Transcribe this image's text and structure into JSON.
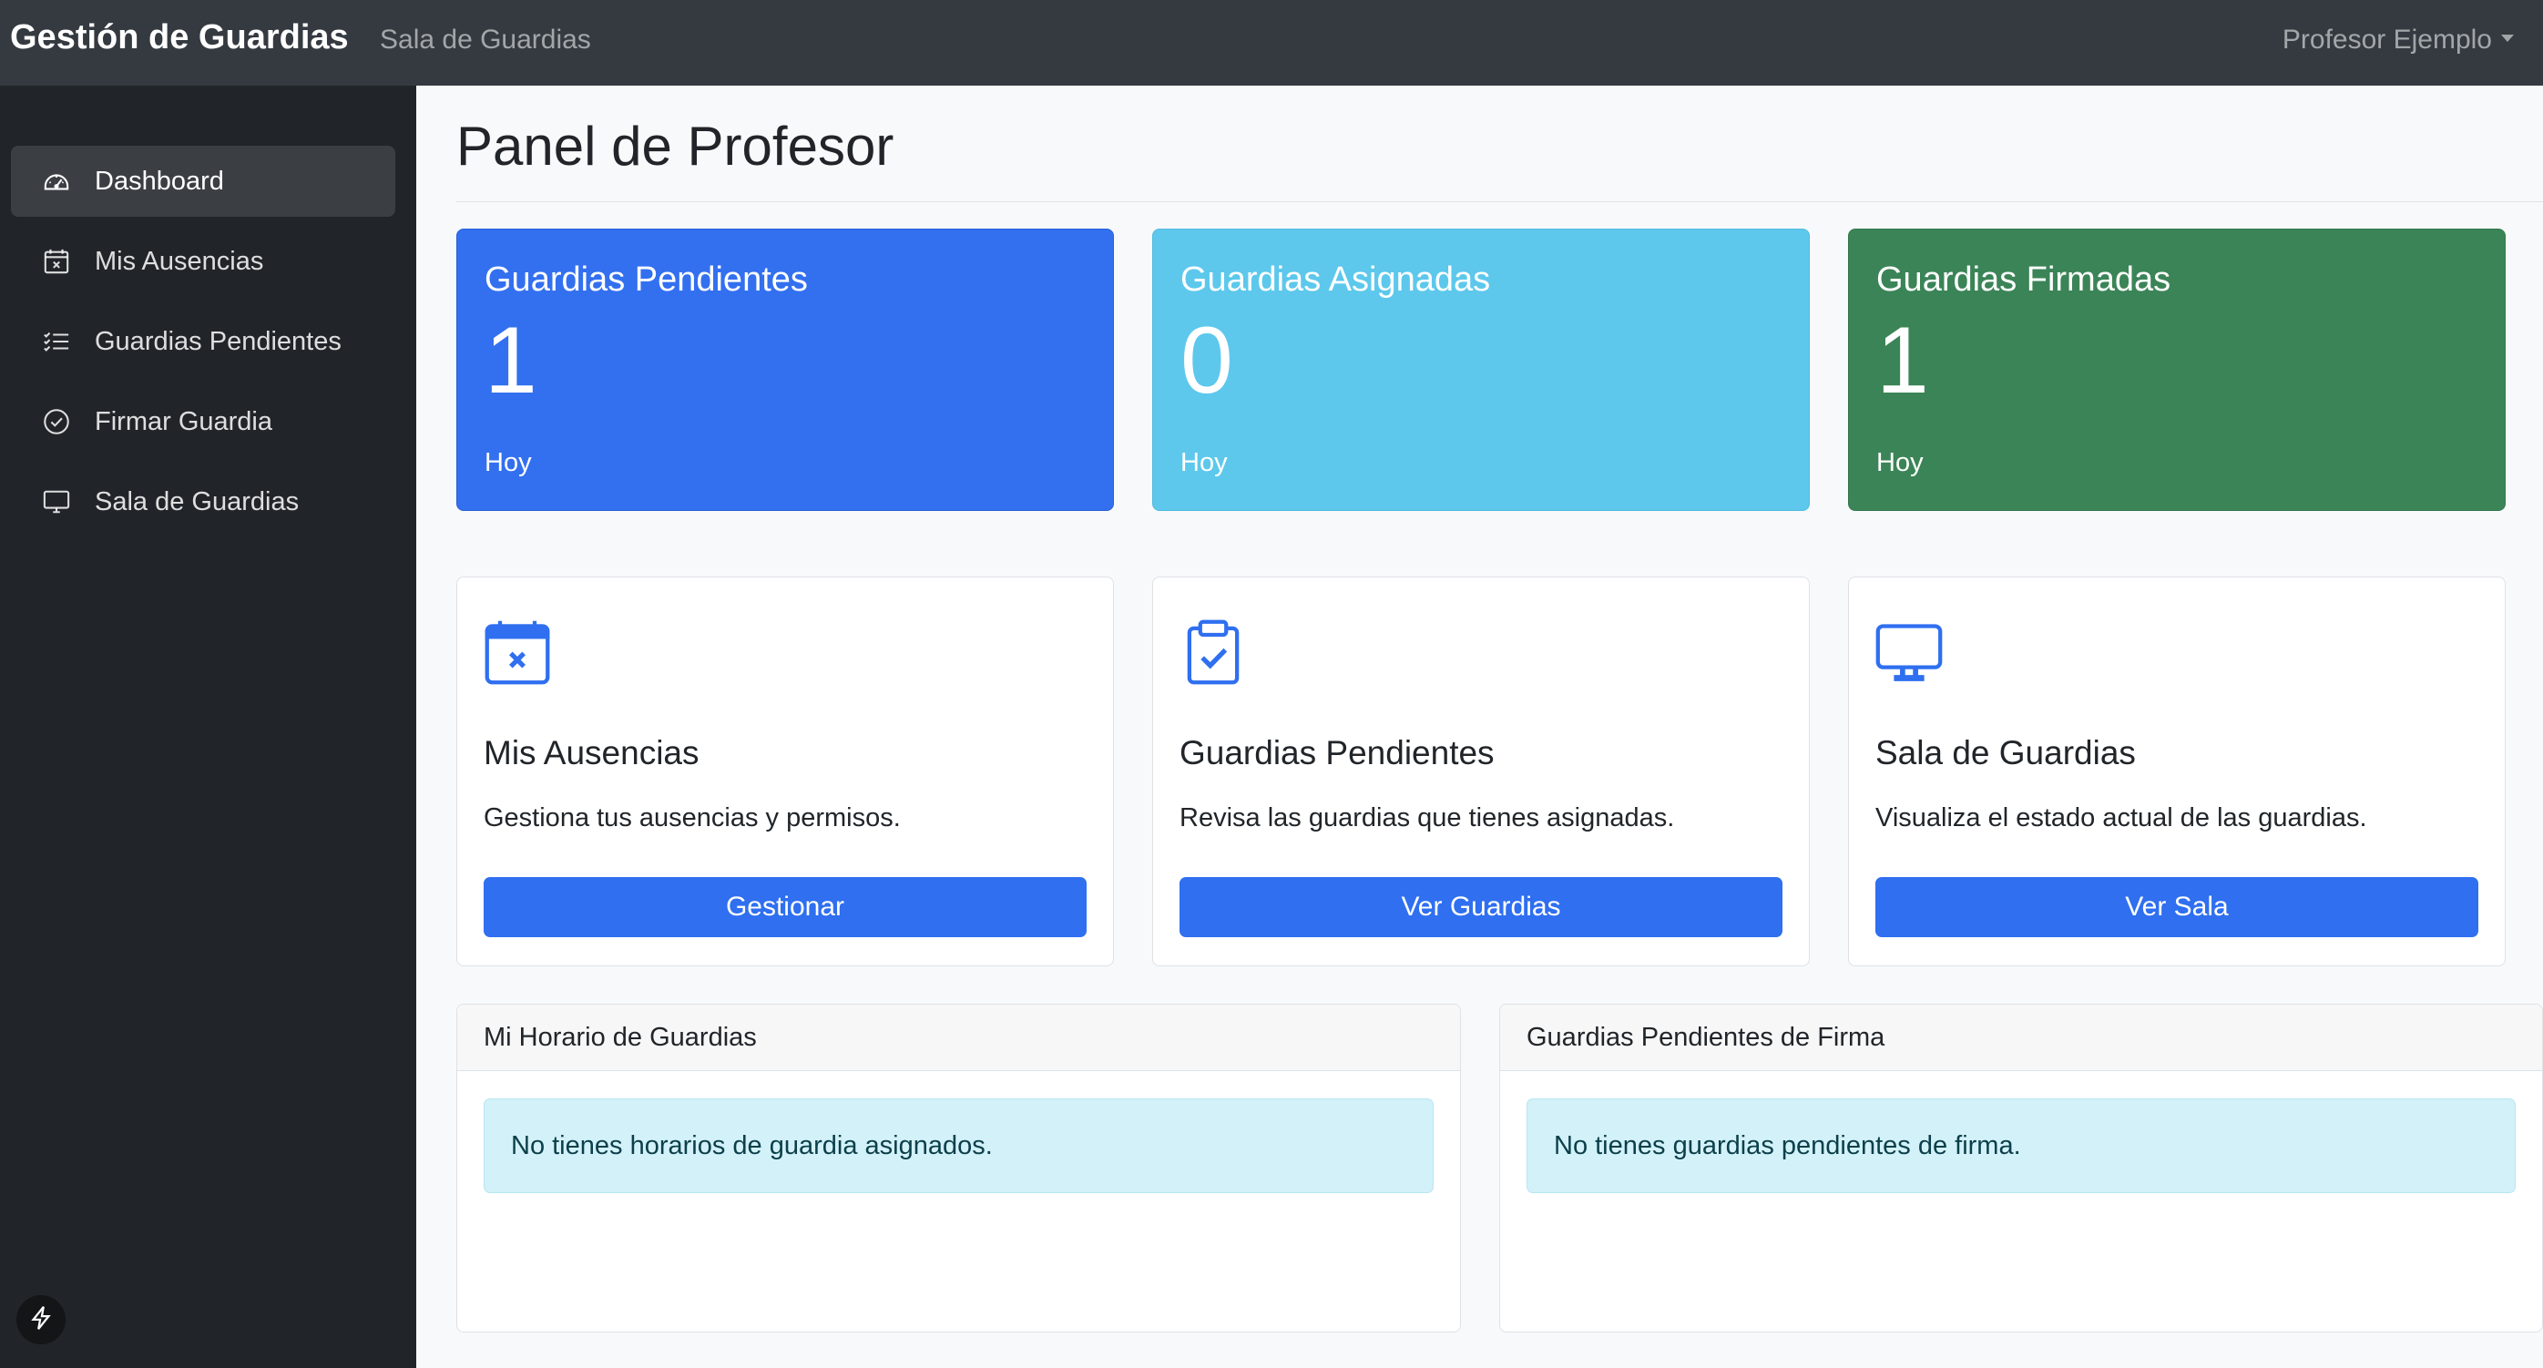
{
  "navbar": {
    "brand": "Gestión de Guardias",
    "link": "Sala de Guardias",
    "user": "Profesor Ejemplo"
  },
  "sidebar": {
    "items": [
      {
        "label": "Dashboard",
        "icon": "speedometer-icon",
        "active": true
      },
      {
        "label": "Mis Ausencias",
        "icon": "calendar-x-icon",
        "active": false
      },
      {
        "label": "Guardias Pendientes",
        "icon": "list-check-icon",
        "active": false
      },
      {
        "label": "Firmar Guardia",
        "icon": "check-circle-icon",
        "active": false
      },
      {
        "label": "Sala de Guardias",
        "icon": "display-icon",
        "active": false
      }
    ],
    "bottom_icon": "lightning-icon"
  },
  "main": {
    "title": "Panel de Profesor",
    "stats": [
      {
        "title": "Guardias Pendientes",
        "value": "1",
        "sub": "Hoy",
        "color": "#3370f0"
      },
      {
        "title": "Guardias Asignadas",
        "value": "0",
        "sub": "Hoy",
        "color": "#5dc8ec"
      },
      {
        "title": "Guardias Firmadas",
        "value": "1",
        "sub": "Hoy",
        "color": "#3b8457"
      }
    ],
    "features": [
      {
        "icon": "calendar-x-icon",
        "title": "Mis Ausencias",
        "text": "Gestiona tus ausencias y permisos.",
        "button": "Gestionar"
      },
      {
        "icon": "clipboard-check-icon",
        "title": "Guardias Pendientes",
        "text": "Revisa las guardias que tienes asignadas.",
        "button": "Ver Guardias"
      },
      {
        "icon": "display-icon",
        "title": "Sala de Guardias",
        "text": "Visualiza el estado actual de las guardias.",
        "button": "Ver Sala"
      }
    ],
    "panels": [
      {
        "header": "Mi Horario de Guardias",
        "message": "No tienes horarios de guardia asignados."
      },
      {
        "header": "Guardias Pendientes de Firma",
        "message": "No tienes guardias pendientes de firma."
      }
    ]
  },
  "colors": {
    "navbar": "#343a40",
    "sidebar": "#212529",
    "primary": "#2f6ff0",
    "info_alert": "#d3f1f8"
  }
}
